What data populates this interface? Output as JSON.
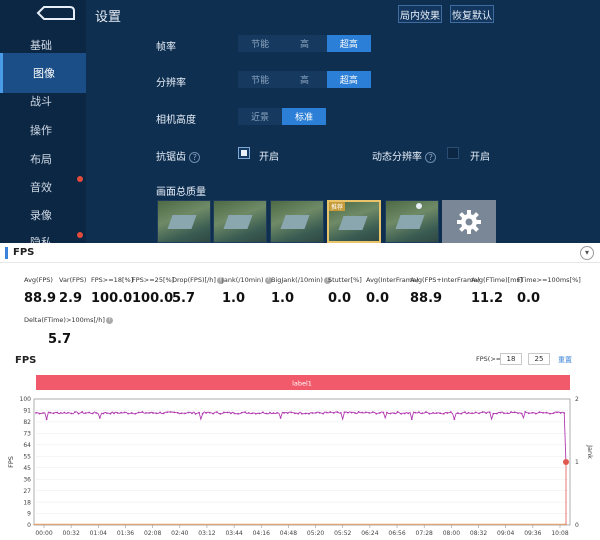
{
  "game": {
    "title": "设置",
    "sidebar": [
      {
        "label": "基础",
        "active": false
      },
      {
        "label": "图像",
        "active": true
      },
      {
        "label": "战斗",
        "active": false
      },
      {
        "label": "操作",
        "active": false
      },
      {
        "label": "布局",
        "active": false
      },
      {
        "label": "音效",
        "active": false
      },
      {
        "label": "录像",
        "active": false
      },
      {
        "label": "隐私",
        "active": false
      }
    ],
    "buttons": {
      "local_effect": "局内效果",
      "restore_default": "恢复默认"
    },
    "frame_rate": {
      "label": "帧率",
      "options": [
        "节能",
        "高",
        "超高"
      ],
      "selected": "超高"
    },
    "resolution": {
      "label": "分辨率",
      "options": [
        "节能",
        "高",
        "超高"
      ],
      "selected": "超高"
    },
    "camera_height": {
      "label": "相机高度",
      "options": [
        "近景",
        "标准"
      ],
      "selected": "标准"
    },
    "anti_aliasing": {
      "label": "抗锯齿",
      "option_label": "开启",
      "checked": true
    },
    "dynamic_resolution": {
      "label": "动态分辨率",
      "option_label": "开启",
      "checked": false
    },
    "quality": {
      "label": "画面总质量",
      "selected_badge": "推荐"
    }
  },
  "panel": {
    "title": "FPS",
    "metrics": [
      {
        "label": "Avg(FPS)",
        "value": "88.9",
        "help": false
      },
      {
        "label": "Var(FPS)",
        "value": "2.9",
        "help": false
      },
      {
        "label": "FPS>=18[%]",
        "value": "100.0",
        "help": false
      },
      {
        "label": "FPS>=25[%]",
        "value": "100.0",
        "help": false
      },
      {
        "label": "Drop(FPS)[/h]",
        "value": "5.7",
        "help": true
      },
      {
        "label": "Jank(/10min)",
        "value": "1.0",
        "help": true
      },
      {
        "label": "BigJank(/10min)",
        "value": "1.0",
        "help": true
      },
      {
        "label": "Stutter[%]",
        "value": "0.0",
        "help": false
      },
      {
        "label": "Avg(InterFrame)",
        "value": "0.0",
        "help": false
      },
      {
        "label": "Avg(FPS+InterFrame)",
        "value": "88.9",
        "help": false
      },
      {
        "label": "Avg(FTime)[ms]",
        "value": "11.2",
        "help": false
      },
      {
        "label": "FTime>=100ms[%]",
        "value": "0.0",
        "help": false
      },
      {
        "label": "Delta(FTime)>100ms[/h]",
        "value": "5.7",
        "help": true
      }
    ],
    "chart_title": "FPS",
    "filter": {
      "label": "FPS(>=)",
      "min": "18",
      "max": "25",
      "reset": "重置"
    }
  },
  "chart_data": {
    "type": "line",
    "band_label": "label1",
    "ylabel": "FPS",
    "y2label": "Jank",
    "ylim": [
      0,
      100
    ],
    "y2lim": [
      0,
      2
    ],
    "y_ticks": [
      "100",
      "91",
      "82",
      "73",
      "64",
      "55",
      "45",
      "36",
      "27",
      "18",
      "9",
      "0"
    ],
    "y2_ticks": [
      "2",
      "1",
      "0"
    ],
    "x_ticks": [
      "00:00",
      "00:32",
      "01:04",
      "01:36",
      "02:08",
      "02:40",
      "03:12",
      "03:44",
      "04:16",
      "04:48",
      "05:20",
      "05:52",
      "06:24",
      "06:56",
      "07:28",
      "08:00",
      "08:32",
      "09:04",
      "09:36",
      "10:08"
    ],
    "series": [
      {
        "name": "FPS",
        "color": "#b13bb0",
        "baseline": 89,
        "dips": [
          [
            0.02,
            84
          ],
          [
            0.12,
            85
          ],
          [
            0.31,
            84
          ],
          [
            0.46,
            85
          ],
          [
            0.58,
            84
          ],
          [
            0.66,
            85
          ],
          [
            0.71,
            84
          ],
          [
            0.79,
            84
          ],
          [
            0.86,
            84
          ],
          [
            0.92,
            85
          ],
          [
            1.0,
            48
          ]
        ]
      },
      {
        "name": "Jank",
        "color": "#e0594f",
        "events": [
          [
            1.0,
            1
          ]
        ]
      }
    ],
    "colors": {
      "band": "#f15a6b",
      "axis": "#9a9a9a",
      "grid": "#ebebeb"
    }
  }
}
